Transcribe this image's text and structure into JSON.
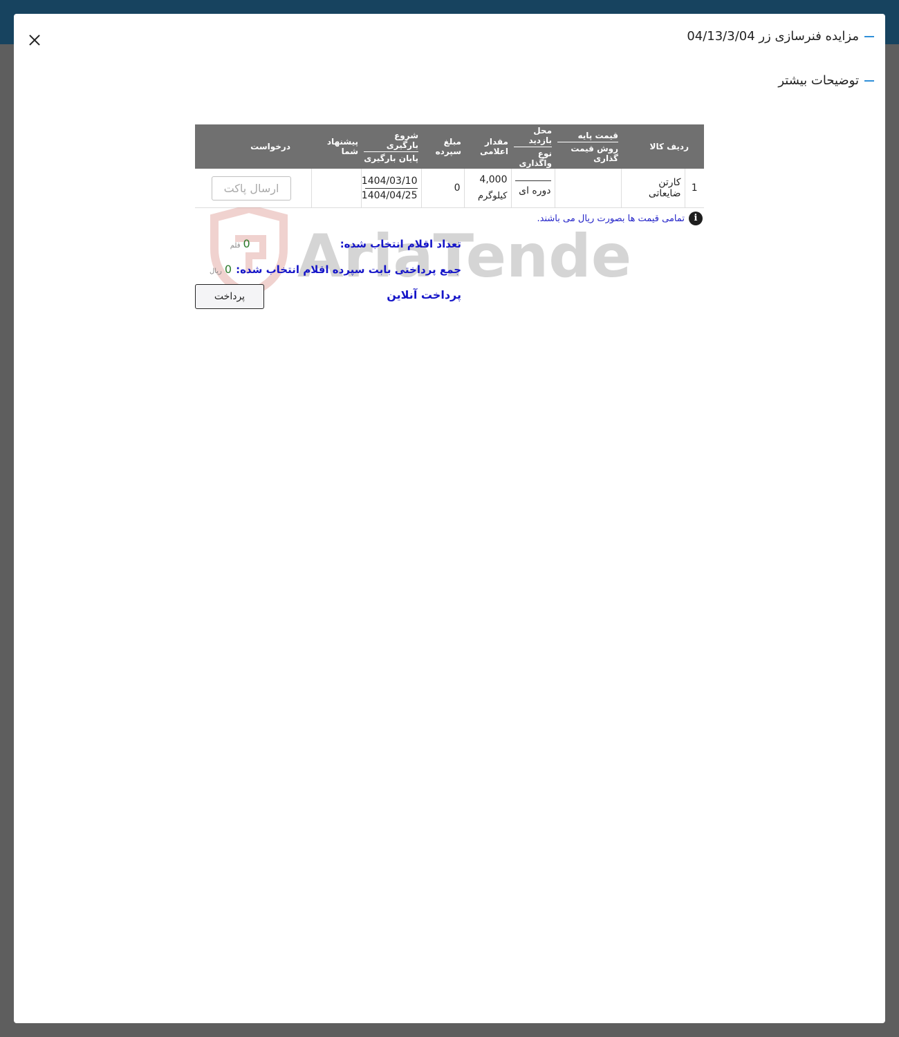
{
  "modal": {
    "title": "مزایده فنرسازی زر 04/13/3/04",
    "more_section": "توضیحات بیشتر"
  },
  "table": {
    "headers": {
      "row_item": "ردیف کالا",
      "base_price": "قیمت پایه",
      "pricing_method": "روش قیمت گذاری",
      "visit_place": "محل بازدید",
      "assignment_type": "نوع واگذاری",
      "announced_qty": "مقدار اعلامی",
      "deposit_amount": "مبلغ سپرده",
      "loading_start": "شروع بارگیری",
      "loading_end": "پایان بارگیری",
      "your_offer": "پیشنهاد شما",
      "request": "درخواست"
    },
    "rows": [
      {
        "index": "1",
        "item": "کارتن ضایعاتی",
        "base_price": "",
        "assignment_type": "دوره ای",
        "qty": "4,000",
        "qty_unit": "کیلوگرم",
        "deposit": "0",
        "loading_start": "1404/03/10",
        "loading_end": "1404/04/25",
        "offer": "",
        "request_button": "ارسال پاکت"
      }
    ]
  },
  "note": {
    "icon": "info-icon",
    "text": "تمامی قیمت ها بصورت ریال می باشند."
  },
  "watermark": {
    "text": "AriaTender.neT"
  },
  "summary": {
    "selected_count_label": "تعداد اقلام انتخاب شده:",
    "selected_count": "0",
    "selected_count_unit": "قلم",
    "deposit_total_label": "جمع پرداختی بابت سپرده اقلام انتخاب شده:",
    "deposit_total": "0",
    "deposit_total_unit": "ریال",
    "online_payment": "پرداخت آنلاین",
    "pay_button": "پرداخت"
  },
  "colors": {
    "topbar": "#17435f",
    "accent": "#2f8fd8",
    "table_header": "#707070",
    "link_blue": "#1515c8"
  }
}
